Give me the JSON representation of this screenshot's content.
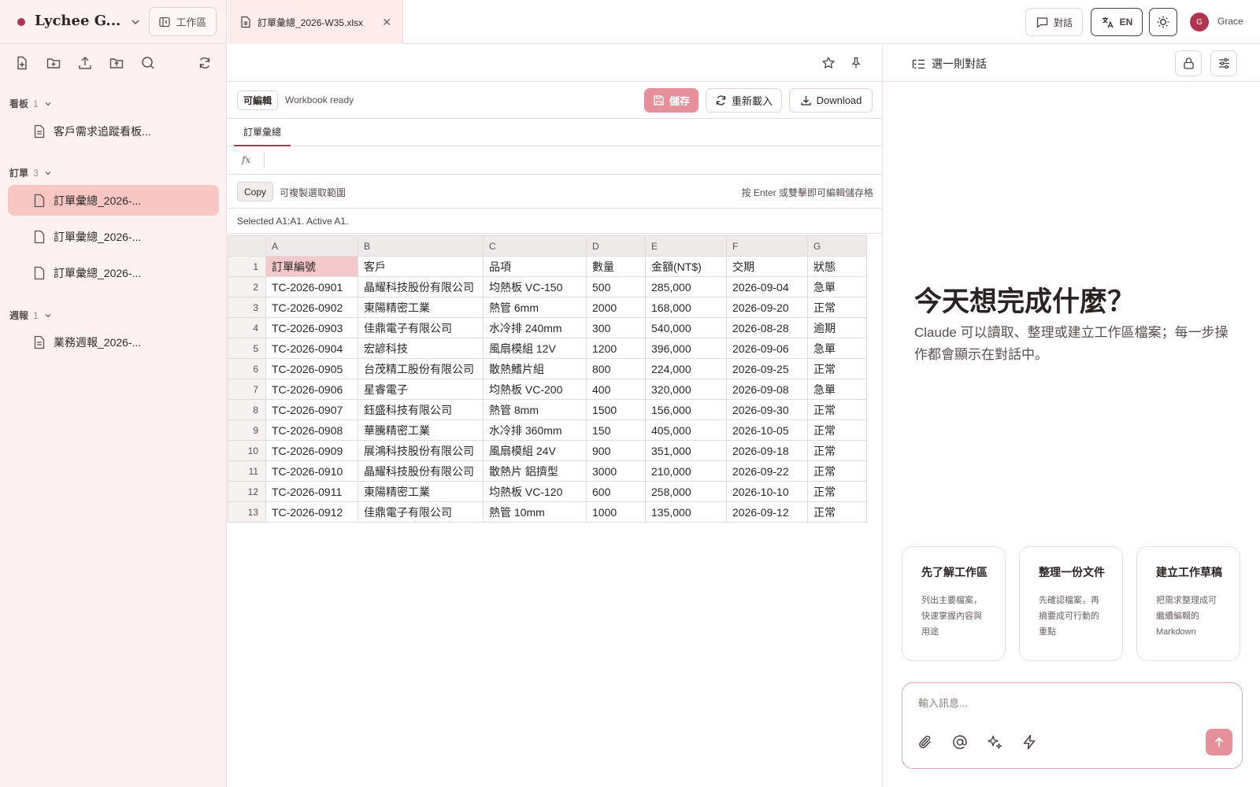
{
  "sidebar": {
    "brand": "Lychee G...",
    "workspace_label": "工作區",
    "sections": [
      {
        "title": "看板",
        "count": "1",
        "items": [
          {
            "label": "客戶需求追蹤看板..."
          }
        ]
      },
      {
        "title": "訂單",
        "count": "3",
        "items": [
          {
            "label": "訂單彙總_2026-..."
          },
          {
            "label": "訂單彙總_2026-..."
          },
          {
            "label": "訂單彙總_2026-..."
          }
        ]
      },
      {
        "title": "週報",
        "count": "1",
        "items": [
          {
            "label": "業務週報_2026-..."
          }
        ]
      }
    ]
  },
  "topbar": {
    "file_tab": "訂單彙總_2026-W35.xlsx",
    "chat_label": "對話",
    "lang_label": "EN",
    "user_initial": "G",
    "user_name": "Grace"
  },
  "editor": {
    "editable_badge": "可編輯",
    "status": "Workbook ready",
    "save_label": "儲存",
    "reload_label": "重新載入",
    "download_label": "Download",
    "sheet_tab": "訂單彙總",
    "fx_label": "fx",
    "copy_label": "Copy",
    "copy_hint": "可複製選取範圍",
    "edit_hint": "按 Enter 或雙擊即可編輯儲存格",
    "selection": "Selected A1:A1. Active A1.",
    "columns": [
      "A",
      "B",
      "C",
      "D",
      "E",
      "F",
      "G"
    ],
    "rows": [
      [
        "訂單編號",
        "客戶",
        "品項",
        "數量",
        "金額(NT$)",
        "交期",
        "狀態"
      ],
      [
        "TC-2026-0901",
        "晶耀科技股份有限公司",
        "均熱板 VC-150",
        "500",
        "285,000",
        "2026-09-04",
        "急單"
      ],
      [
        "TC-2026-0902",
        "東陽精密工業",
        "熱管 6mm",
        "2000",
        "168,000",
        "2026-09-20",
        "正常"
      ],
      [
        "TC-2026-0903",
        "佳鼎電子有限公司",
        "水冷排 240mm",
        "300",
        "540,000",
        "2026-08-28",
        "逾期"
      ],
      [
        "TC-2026-0904",
        "宏諺科技",
        "風扇模組 12V",
        "1200",
        "396,000",
        "2026-09-06",
        "急單"
      ],
      [
        "TC-2026-0905",
        "台茂精工股份有限公司",
        "散熱鰭片組",
        "800",
        "224,000",
        "2026-09-25",
        "正常"
      ],
      [
        "TC-2026-0906",
        "星睿電子",
        "均熱板 VC-200",
        "400",
        "320,000",
        "2026-09-08",
        "急單"
      ],
      [
        "TC-2026-0907",
        "鈺盛科技有限公司",
        "熱管 8mm",
        "1500",
        "156,000",
        "2026-09-30",
        "正常"
      ],
      [
        "TC-2026-0908",
        "華騰精密工業",
        "水冷排 360mm",
        "150",
        "405,000",
        "2026-10-05",
        "正常"
      ],
      [
        "TC-2026-0909",
        "展鴻科技股份有限公司",
        "風扇模組 24V",
        "900",
        "351,000",
        "2026-09-18",
        "正常"
      ],
      [
        "TC-2026-0910",
        "晶耀科技股份有限公司",
        "散熱片 鋁擠型",
        "3000",
        "210,000",
        "2026-09-22",
        "正常"
      ],
      [
        "TC-2026-0911",
        "東陽精密工業",
        "均熱板 VC-120",
        "600",
        "258,000",
        "2026-10-10",
        "正常"
      ],
      [
        "TC-2026-0912",
        "佳鼎電子有限公司",
        "熱管 10mm",
        "1000",
        "135,000",
        "2026-09-12",
        "正常"
      ]
    ]
  },
  "chat": {
    "title": "選一則對話",
    "hero_title": "今天想完成什麼？",
    "hero_subtitle": "Claude 可以讀取、整理或建立工作區檔案；每一步操作都會顯示在對話中。",
    "cards": [
      {
        "title": "先了解工作區",
        "desc": "列出主要檔案，快速掌握內容與用途"
      },
      {
        "title": "整理一份文件",
        "desc": "先確認檔案，再摘要成可行動的重點"
      },
      {
        "title": "建立工作草稿",
        "desc": "把需求整理成可繼續編輯的 Markdown"
      }
    ],
    "input_placeholder": "輸入訊息..."
  },
  "colors": {
    "accent": "#b0334f",
    "active_item": "#f8c7c3",
    "save_button": "#e5909b",
    "sidebar_bg": "#fdf2f1"
  }
}
